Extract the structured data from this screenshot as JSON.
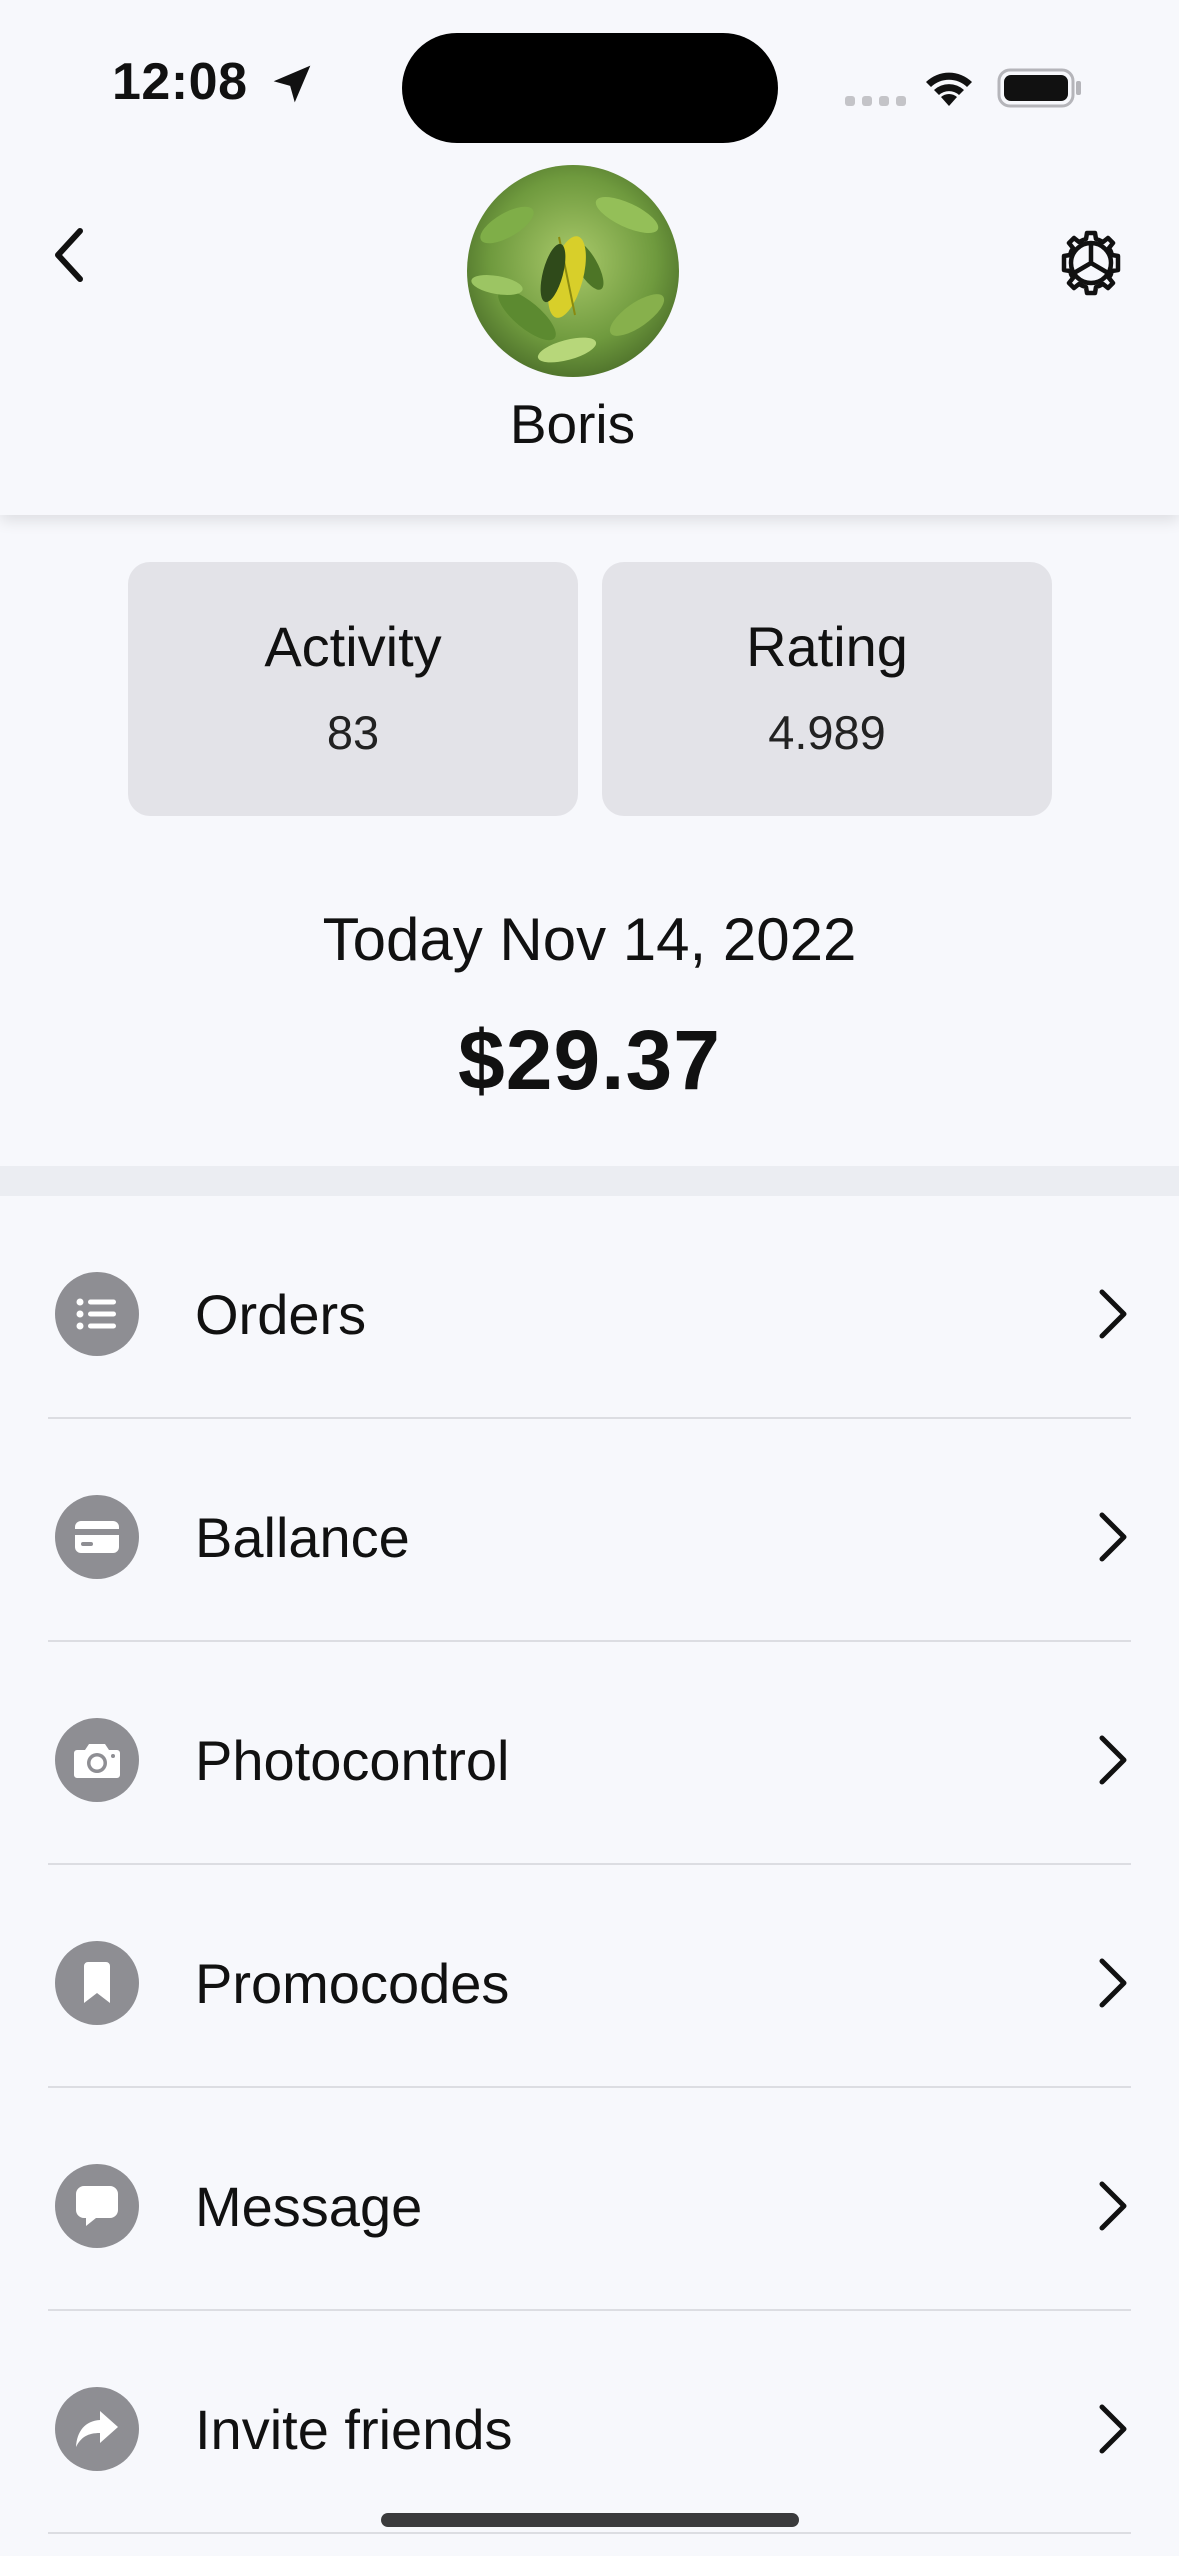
{
  "status_bar": {
    "time": "12:08"
  },
  "header": {
    "user_name": "Boris",
    "avatar": "avatar-leaf-photo",
    "back_icon": "chevron-left-icon",
    "settings_icon": "gear-icon"
  },
  "stats": {
    "activity_label": "Activity",
    "activity_value": "83",
    "rating_label": "Rating",
    "rating_value": "4.989"
  },
  "summary": {
    "date_text": "Today Nov 14, 2022",
    "amount": "$29.37"
  },
  "menu": {
    "items": [
      {
        "label": "Orders",
        "icon": "list-icon"
      },
      {
        "label": "Ballance",
        "icon": "card-icon"
      },
      {
        "label": "Photocontrol",
        "icon": "camera-icon"
      },
      {
        "label": "Promocodes",
        "icon": "bookmark-icon"
      },
      {
        "label": "Message",
        "icon": "chat-bubble-icon"
      },
      {
        "label": "Invite friends",
        "icon": "share-arrow-icon"
      }
    ]
  },
  "colors": {
    "background": "#f7f8fc",
    "card": "#e3e3e8",
    "icon_circle": "#8e8e93",
    "divider": "#dcdde2"
  }
}
